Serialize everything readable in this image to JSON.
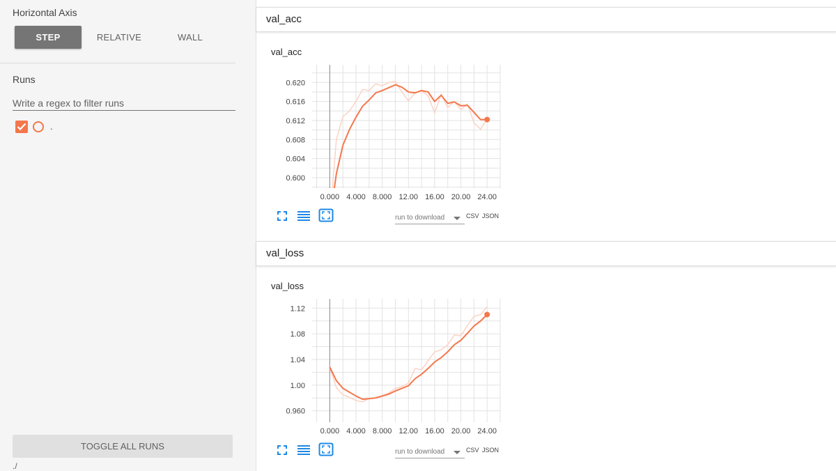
{
  "sidebar": {
    "horizontal_axis_title": "Horizontal Axis",
    "axis_options": [
      "STEP",
      "RELATIVE",
      "WALL"
    ],
    "selected_axis": "STEP",
    "runs_title": "Runs",
    "regex_placeholder": "Write a regex to filter runs",
    "runs": [
      {
        "label": ".",
        "checked": true
      }
    ],
    "toggle_all_label": "TOGGLE ALL RUNS",
    "logdir": "./"
  },
  "colors": {
    "run": "#f4774b",
    "run_raw": "#fbd3c5",
    "selected_button": "#757575",
    "icon": "#1e88e5"
  },
  "sections": [
    {
      "header": "val_acc",
      "card_title": "val_acc"
    },
    {
      "header": "val_loss",
      "card_title": "val_loss"
    }
  ],
  "controls": {
    "fit_icon": "fit-domain-icon",
    "log_icon": "log-scale-icon",
    "expand_icon": "expand-icon",
    "download_placeholder": "run to download",
    "csv_label": "CSV",
    "json_label": "JSON"
  },
  "chart_data": [
    {
      "type": "line",
      "title": "val_acc",
      "x_tick_labels": [
        "0.000",
        "4.000",
        "8.000",
        "12.00",
        "16.00",
        "20.00",
        "24.00"
      ],
      "y_tick_labels": [
        "0.600",
        "0.604",
        "0.608",
        "0.612",
        "0.616",
        "0.620"
      ],
      "xlim": [
        -2.7,
        26
      ],
      "ylim": [
        0.5978,
        0.6237
      ],
      "grid": true,
      "series": [
        {
          "style": "smoothed",
          "x": [
            0,
            1,
            2,
            3,
            4,
            5,
            6,
            7,
            8,
            9,
            10,
            11,
            12,
            13,
            14,
            15,
            16,
            17,
            18,
            19,
            20,
            21,
            22,
            23,
            24
          ],
          "y": [
            0.591,
            0.6008,
            0.6068,
            0.6101,
            0.6127,
            0.615,
            0.6163,
            0.6178,
            0.6183,
            0.6189,
            0.6195,
            0.619,
            0.618,
            0.6178,
            0.6183,
            0.618,
            0.616,
            0.6173,
            0.6156,
            0.6159,
            0.6151,
            0.6152,
            0.6137,
            0.6122,
            0.6122
          ]
        },
        {
          "style": "raw",
          "x": [
            0,
            1,
            2,
            3,
            4,
            5,
            6,
            7,
            8,
            9,
            10,
            11,
            12,
            13,
            14,
            15,
            16,
            17,
            18,
            19,
            20,
            21,
            22,
            23,
            24
          ],
          "y": [
            0.591,
            0.608,
            0.6128,
            0.614,
            0.616,
            0.6185,
            0.6183,
            0.6197,
            0.6193,
            0.62,
            0.6202,
            0.618,
            0.6161,
            0.6178,
            0.6182,
            0.6172,
            0.6136,
            0.6175,
            0.6147,
            0.616,
            0.6143,
            0.6155,
            0.6115,
            0.6102,
            0.6123
          ]
        }
      ]
    },
    {
      "type": "line",
      "title": "val_loss",
      "x_tick_labels": [
        "0.000",
        "4.000",
        "8.000",
        "12.00",
        "16.00",
        "20.00",
        "24.00"
      ],
      "y_tick_labels": [
        "0.960",
        "1.00",
        "1.04",
        "1.08",
        "1.12"
      ],
      "xlim": [
        -2.7,
        26
      ],
      "ylim": [
        0.9422,
        1.1344
      ],
      "grid": true,
      "series": [
        {
          "style": "smoothed",
          "x": [
            0,
            1,
            2,
            3,
            4,
            5,
            6,
            7,
            8,
            9,
            10,
            11,
            12,
            13,
            14,
            15,
            16,
            17,
            18,
            19,
            20,
            21,
            22,
            23,
            24
          ],
          "y": [
            1.028,
            1.007,
            0.995,
            0.989,
            0.983,
            0.978,
            0.979,
            0.98,
            0.983,
            0.986,
            0.991,
            0.995,
            0.999,
            1.01,
            1.017,
            1.026,
            1.036,
            1.043,
            1.052,
            1.063,
            1.07,
            1.081,
            1.092,
            1.1,
            1.11
          ]
        },
        {
          "style": "raw",
          "x": [
            0,
            1,
            2,
            3,
            4,
            5,
            6,
            7,
            8,
            9,
            10,
            11,
            12,
            13,
            14,
            15,
            16,
            17,
            18,
            19,
            20,
            21,
            22,
            23,
            24
          ],
          "y": [
            1.028,
            0.996,
            0.985,
            0.981,
            0.976,
            0.974,
            0.979,
            0.981,
            0.984,
            0.988,
            0.995,
            0.998,
            1.003,
            1.026,
            1.024,
            1.038,
            1.052,
            1.055,
            1.063,
            1.078,
            1.077,
            1.093,
            1.107,
            1.11,
            1.122
          ]
        }
      ]
    }
  ]
}
